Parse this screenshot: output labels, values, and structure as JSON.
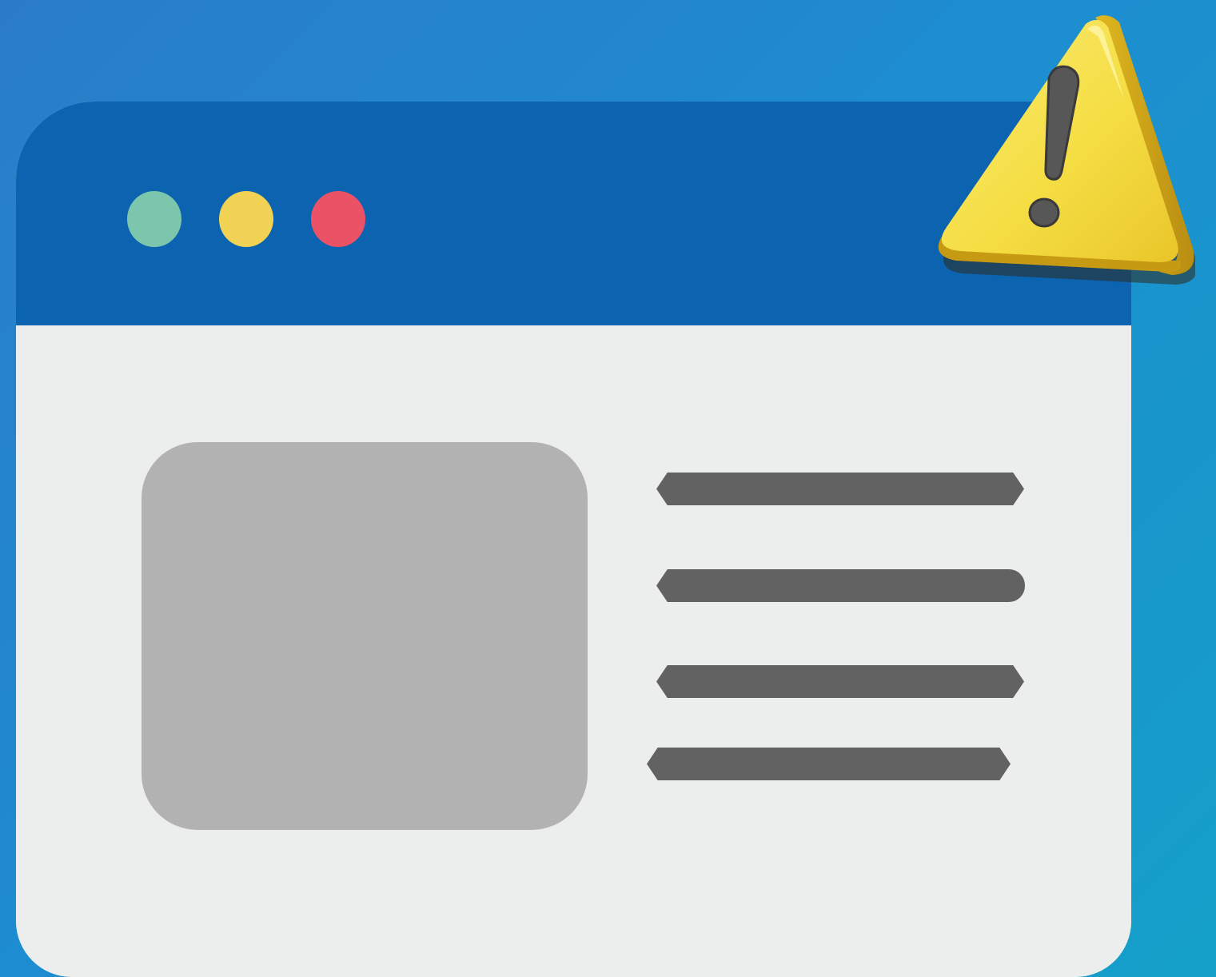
{
  "window": {
    "traffic_lights": [
      {
        "name": "green",
        "color": "#7cc6ad"
      },
      {
        "name": "yellow",
        "color": "#f2d254"
      },
      {
        "name": "red",
        "color": "#eb5266"
      }
    ],
    "title_bar_color": "#0c64b0",
    "content_background": "#eceeee"
  },
  "content": {
    "image_placeholder_color": "#b2b2b2",
    "text_line_color": "#626262",
    "text_line_count": 4
  },
  "warning": {
    "icon": "warning-triangle-icon",
    "triangle_color": "#f7e04a",
    "exclamation_color": "#585858"
  },
  "background": {
    "gradient_start": "#2a7cc8",
    "gradient_end": "#14a0c8"
  }
}
